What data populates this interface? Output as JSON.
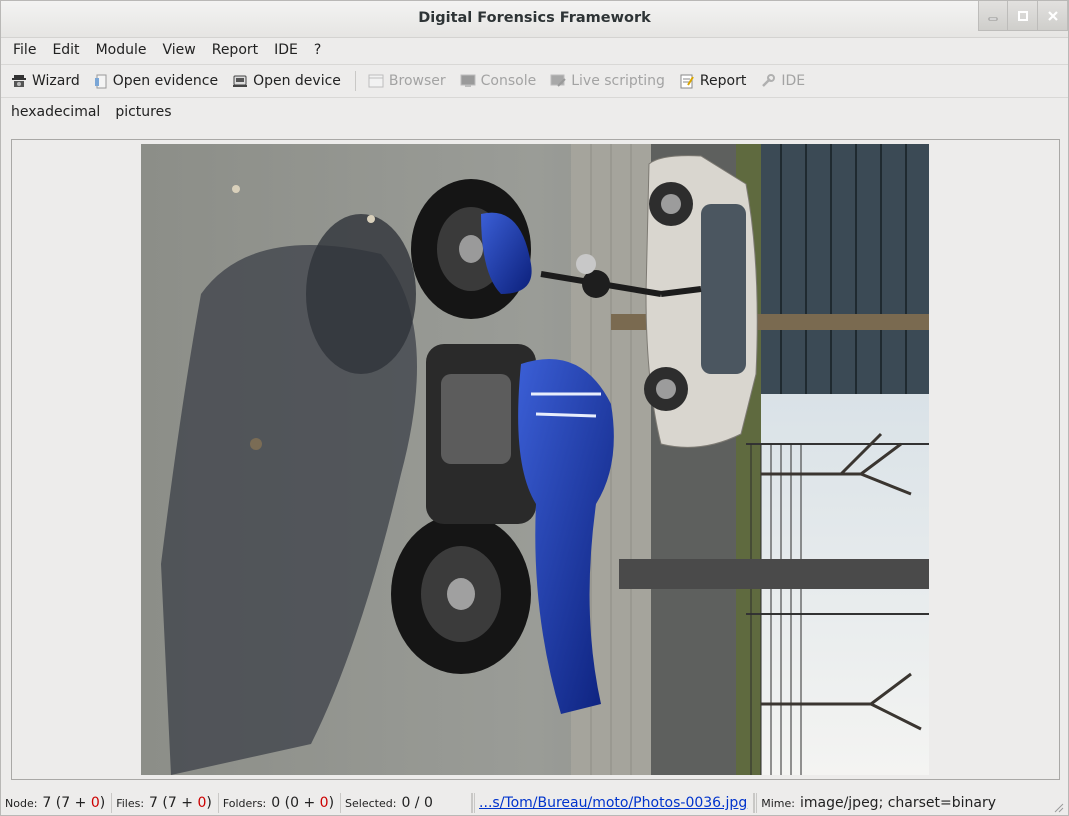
{
  "window": {
    "title": "Digital Forensics Framework"
  },
  "menu": [
    "File",
    "Edit",
    "Module",
    "View",
    "Report",
    "IDE",
    "?"
  ],
  "toolbar": {
    "wizard": "Wizard",
    "open_evidence": "Open evidence",
    "open_device": "Open device",
    "browser": "Browser",
    "console": "Console",
    "live_scripting": "Live scripting",
    "report": "Report",
    "ide": "IDE"
  },
  "tabs": [
    "hexadecimal",
    "pictures"
  ],
  "viewer": {
    "image_subject": "blue motorcycle parked on sidewalk photo"
  },
  "status": {
    "node_key": "Node:",
    "node_total": "7",
    "node_open": "(7 +",
    "node_deleted": "0",
    "node_close": ")",
    "files_key": "Files:",
    "files_total": "7",
    "files_open": "(7 +",
    "files_deleted": "0",
    "files_close": ")",
    "folders_key": "Folders:",
    "folders_total": "0",
    "folders_open": "(0 +",
    "folders_deleted": "0",
    "folders_close": ")",
    "selected_key": "Selected:",
    "selected_value": "0 / 0",
    "path": "...s/Tom/Bureau/moto/Photos-0036.jpg",
    "mime_key": "Mime:",
    "mime_value": "image/jpeg; charset=binary"
  }
}
